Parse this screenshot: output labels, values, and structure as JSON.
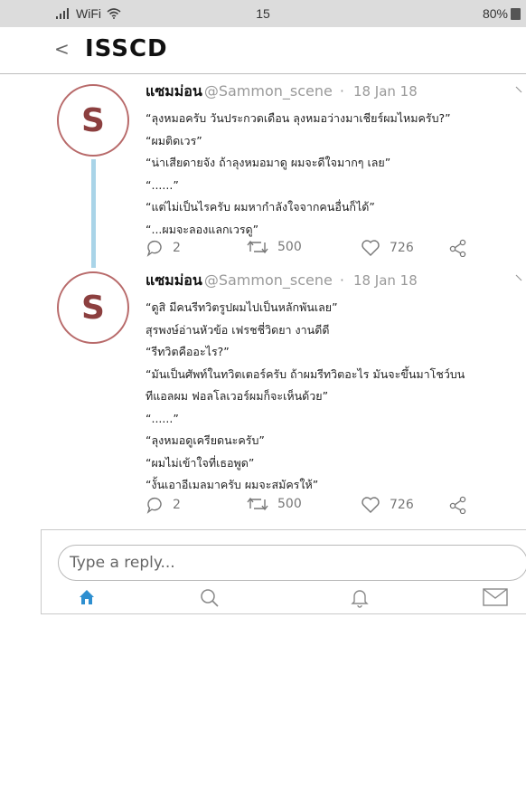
{
  "status_bar": {
    "signal": "WiFi",
    "time": "15",
    "battery": "80%"
  },
  "header": {
    "back_label": "<",
    "title": "ISSCD"
  },
  "tweets": [
    {
      "avatar_letter": "S",
      "name": "แซมม่อน",
      "handle": "@Sammon_scene",
      "separator": "·",
      "date": "18 Jan 18",
      "lines": [
        "“ลุงหมอครับ วันประกวดเดือน ลุงหมอว่างมาเชียร์ผมไหมครับ?”",
        "“ผมติดเวร”",
        "“น่าเสียดายจัง ถ้าลุงหมอมาดู ผมจะดีใจมากๆ เลย”",
        "“......”",
        "“แต่ไม่เป็นไรครับ ผมหากำลังใจจากคนอื่นก็ได้”",
        "“...ผมจะลองแลกเวรดู”"
      ],
      "replies": "2",
      "retweets": "500",
      "likes": "726"
    },
    {
      "avatar_letter": "S",
      "name": "แซมม่อน",
      "handle": "@Sammon_scene",
      "separator": "·",
      "date": "18 Jan 18",
      "lines": [
        "“ดูสิ มีคนรีทวิตรูปผมไปเป็นหลักพันเลย”",
        "สุรพงษ์อ่านหัวข้อ เฟรชชี่วิดยา งานดีดี",
        "“รีทวิตคืออะไร?”",
        "“มันเป็นศัพท์ในทวิตเตอร์ครับ ถ้าผมรีทวิตอะไร มันจะขึ้นมาโชว์บน",
        "ทีแอลผม ฟอลโลเวอร์ผมก็จะเห็นด้วย”",
        "“......”",
        "“ลุงหมอดูเครียดนะครับ”",
        "“ผมไม่เข้าใจที่เธอพูด”",
        "“งั้นเอาอีเมลมาครับ ผมจะสมัครให้”"
      ],
      "replies": "2",
      "retweets": "500",
      "likes": "726"
    }
  ],
  "compose": {
    "placeholder": "Type a reply..."
  },
  "bottom_nav": [
    {
      "icon": "home-icon",
      "active": true
    },
    {
      "icon": "search-icon",
      "active": false
    },
    {
      "icon": "bell-icon",
      "active": false
    },
    {
      "icon": "mail-icon",
      "active": false
    }
  ],
  "colors": {
    "accent": "#2e8fd0",
    "avatar_border": "#b86a6a",
    "avatar_letter": "#8c3f3f",
    "thread_line": "#a9d4e8"
  }
}
